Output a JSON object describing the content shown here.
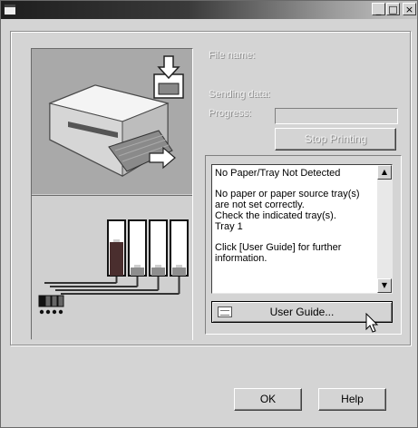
{
  "window": {
    "title": "",
    "controls": {
      "minimize": "_",
      "maximize": "□",
      "close": "×"
    }
  },
  "info": {
    "file_name_label": "File name:",
    "sending_data_label": "Sending data:",
    "progress_label": "Progress:",
    "stop_printing_label": "Stop Printing"
  },
  "message": {
    "title": "No Paper/Tray Not Detected",
    "line1": "No paper or paper source tray(s)",
    "line2": "are not set correctly.",
    "line3": "Check the indicated tray(s).",
    "line4": "Tray 1",
    "line5": "Click [User Guide] for further",
    "line6": "information."
  },
  "buttons": {
    "user_guide": "User Guide...",
    "ok": "OK",
    "help": "Help"
  },
  "ink_levels": [
    0.6,
    0.15,
    0.15,
    0.15
  ],
  "colors": {
    "background": "#d4d4d4",
    "printer_panel": "#a9a9a9"
  }
}
